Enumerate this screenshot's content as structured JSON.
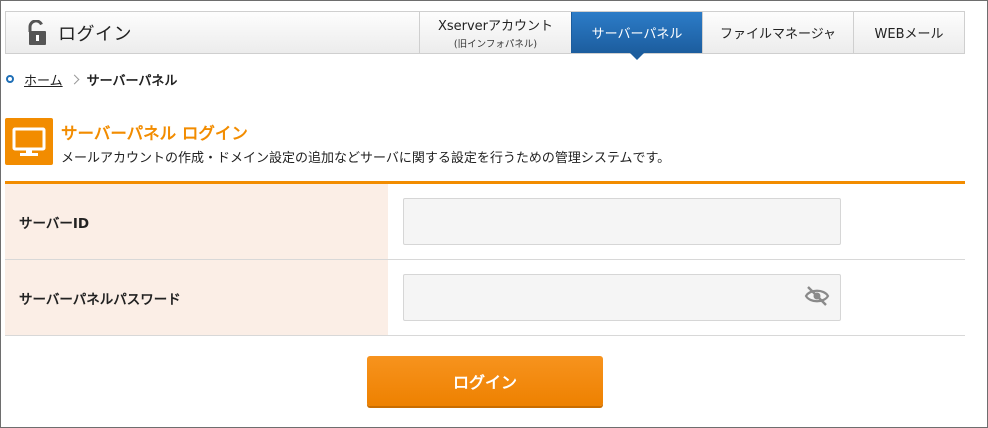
{
  "header": {
    "title": "ログイン",
    "tabs": [
      {
        "label": "Xserverアカウント",
        "sub": "(旧インフォパネル)"
      },
      {
        "label": "サーバーパネル",
        "active": true
      },
      {
        "label": "ファイルマネージャ"
      },
      {
        "label": "WEBメール"
      }
    ]
  },
  "breadcrumb": {
    "home": "ホーム",
    "current": "サーバーパネル"
  },
  "section": {
    "title": "サーバーパネル ログイン",
    "description": "メールアカウントの作成・ドメイン設定の追加などサーバに関する設定を行うための管理システムです。"
  },
  "form": {
    "server_id_label": "サーバーID",
    "server_id_value": "",
    "password_label": "サーバーパネルパスワード",
    "password_value": "",
    "login_button": "ログイン"
  },
  "colors": {
    "accent": "#f28c00",
    "active_tab": "#1c5d9e",
    "label_bg": "#fbeee6"
  },
  "icons": {
    "header": "unlocked-padlock-icon",
    "section": "monitor-icon",
    "password_toggle": "eye-slash-icon"
  }
}
